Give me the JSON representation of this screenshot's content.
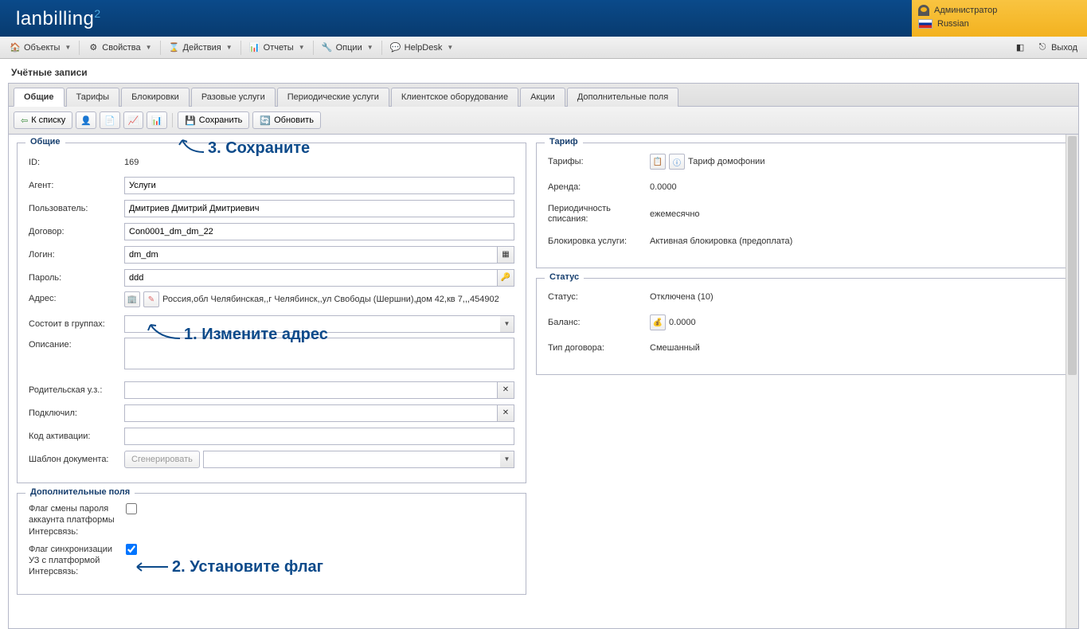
{
  "brand": "lanbilling",
  "header": {
    "user": "Администратор",
    "lang": "Russian",
    "exit": "Выход"
  },
  "menu": {
    "objects": "Объекты",
    "properties": "Свойства",
    "actions": "Действия",
    "reports": "Отчеты",
    "options": "Опции",
    "helpdesk": "HelpDesk"
  },
  "page_title": "Учётные записи",
  "tabs": [
    "Общие",
    "Тарифы",
    "Блокировки",
    "Разовые услуги",
    "Периодические услуги",
    "Клиентское оборудование",
    "Акции",
    "Дополнительные поля"
  ],
  "toolbar": {
    "to_list": "К списку",
    "save": "Сохранить",
    "refresh": "Обновить"
  },
  "general": {
    "legend": "Общие",
    "id_label": "ID:",
    "id": "169",
    "agent_label": "Агент:",
    "agent": "Услуги",
    "user_label": "Пользователь:",
    "user": "Дмитриев Дмитрий Дмитриевич",
    "contract_label": "Договор:",
    "contract": "Con0001_dm_dm_22",
    "login_label": "Логин:",
    "login": "dm_dm",
    "password_label": "Пароль:",
    "password": "ddd",
    "address_label": "Адрес:",
    "address": "Россия,обл Челябинская,,г Челябинск,,ул Свободы (Шершни),дом 42,кв 7,,,454902",
    "groups_label": "Состоит в группах:",
    "description_label": "Описание:",
    "parent_label": "Родительская у.з.:",
    "connected_label": "Подключил:",
    "actcode_label": "Код активации:",
    "doctpl_label": "Шаблон документа:",
    "generate_btn": "Сгенерировать"
  },
  "tariff": {
    "legend": "Тариф",
    "tariffs_label": "Тарифы:",
    "tariff_name": "Тариф домофонии",
    "rent_label": "Аренда:",
    "rent": "0.0000",
    "period_label": "Периодичность списания:",
    "period": "ежемесячно",
    "block_label": "Блокировка услуги:",
    "block": "Активная блокировка (предоплата)"
  },
  "status": {
    "legend": "Статус",
    "status_label": "Статус:",
    "status": "Отключена (10)",
    "balance_label": "Баланс:",
    "balance": "0.0000",
    "contract_type_label": "Тип договора:",
    "contract_type": "Смешанный"
  },
  "addons": {
    "legend": "Дополнительные поля",
    "flag1": "Флаг смены пароля аккаунта платформы Интерсвязь:",
    "flag2": "Флаг синхронизации УЗ с платформой Интерсвязь:"
  },
  "annotations": {
    "a1": "1. Измените адрес",
    "a2": "2. Установите флаг",
    "a3": "3. Сохраните"
  }
}
